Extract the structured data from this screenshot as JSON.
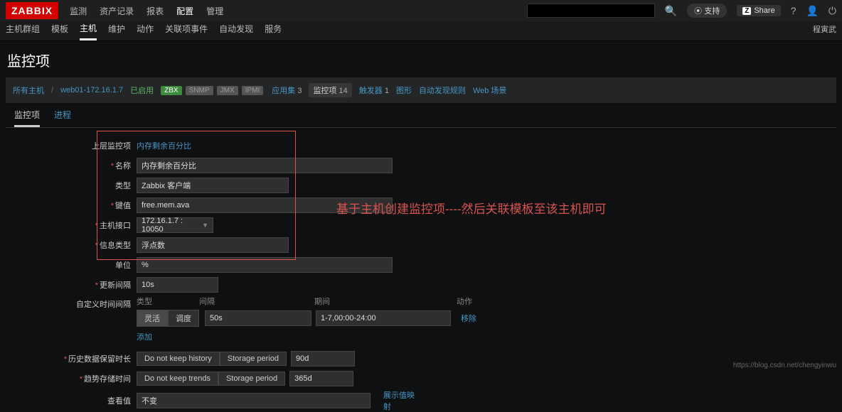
{
  "logo": "ZABBIX",
  "topnav": [
    "监测",
    "资产记录",
    "报表",
    "配置",
    "管理"
  ],
  "topnav_active": 3,
  "support": "⦿ 支持",
  "share": "Share",
  "subnav": [
    "主机群组",
    "模板",
    "主机",
    "维护",
    "动作",
    "关联项事件",
    "自动发现",
    "服务"
  ],
  "subnav_active": 2,
  "userinfo": "程寅武",
  "page_title": "监控项",
  "breadcrumb": {
    "all_hosts": "所有主机",
    "host": "web01-172.16.1.7",
    "status": "已启用",
    "badges": {
      "zbx": "ZBX",
      "snmp": "SNMP",
      "jmx": "JMX",
      "ipmi": "IPMI"
    },
    "links": {
      "apps": {
        "label": "应用集",
        "count": "3"
      },
      "items": {
        "label": "监控项",
        "count": "14",
        "active": true
      },
      "triggers": {
        "label": "触发器",
        "count": "1"
      },
      "graphs": {
        "label": "图形"
      },
      "discovery": {
        "label": "自动发现规则"
      },
      "web": {
        "label": "Web 场景"
      }
    }
  },
  "tabs": [
    "监控项",
    "进程"
  ],
  "tabs_active": 0,
  "form": {
    "parent_label": "上层监控项",
    "parent_link": "内存剩余百分比",
    "name_label": "名称",
    "name_value": "内存剩余百分比",
    "type_label": "类型",
    "type_value": "Zabbix 客户端",
    "key_label": "键值",
    "key_value": "free.mem.ava",
    "interface_label": "主机接口",
    "interface_value": "172.16.1.7 : 10050",
    "info_label": "信息类型",
    "info_value": "浮点数",
    "unit_label": "单位",
    "unit_value": "%",
    "update_label": "更新间隔",
    "update_value": "10s",
    "interval_label": "自定义时间间隔",
    "interval_head": [
      "类型",
      "间隔",
      "期间",
      "动作"
    ],
    "interval_toggle": [
      "灵活",
      "调度"
    ],
    "interval_value": "50s",
    "interval_period": "1-7,00:00-24:00",
    "remove": "移除",
    "add": "添加",
    "history_label": "历史数据保留时长",
    "history_toggle": [
      "Do not keep history",
      "Storage period"
    ],
    "history_value": "90d",
    "trends_label": "趋势存储时间",
    "trends_toggle": [
      "Do not keep trends",
      "Storage period"
    ],
    "trends_value": "365d",
    "show_label": "查看值",
    "show_value": "不变",
    "show_map": "展示值映射"
  },
  "annotation": "基于主机创建监控项----然后关联模板至该主机即可",
  "watermark": "https://blog.csdn.net/chengyinwu"
}
